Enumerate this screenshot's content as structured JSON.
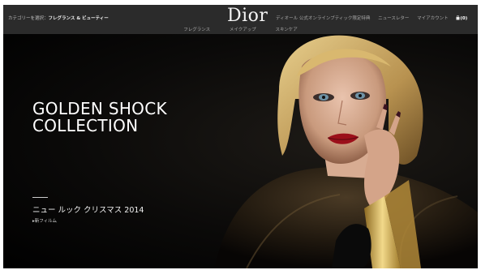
{
  "header": {
    "category_prefix": "カテゴリーを選択：",
    "category_current": "フレグランス & ビューティー",
    "brand": "Dior",
    "nav": [
      "ディオール 公式オンラインブティック限定特典",
      "ニュースレター",
      "マイアカウント"
    ],
    "bag_count": "(0)"
  },
  "subnav": [
    "フレグランス",
    "メイクアップ",
    "スキンケア"
  ],
  "hero": {
    "title_line1": "GOLDEN SHOCK",
    "title_line2": "COLLECTION",
    "subtitle": "ニュー ルック クリスマス 2014",
    "film_link": "新フィルム"
  },
  "colors": {
    "topbar": "#2b2b2b",
    "hero_bg": "#000000",
    "lips": "#9b0f1a",
    "gold": "#c9a44c"
  }
}
